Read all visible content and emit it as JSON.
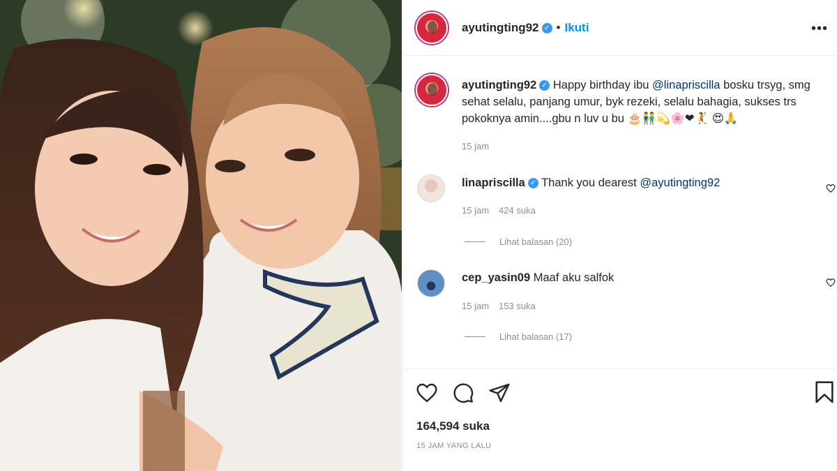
{
  "post": {
    "username": "ayutingting92",
    "follow_label": "Ikuti",
    "separator": "•",
    "more_icon": "more-horizontal-icon"
  },
  "caption": {
    "username": "ayutingting92",
    "text_before": "Happy birthday ibu ",
    "mention": "@linapriscilla",
    "text_after": " bosku trsyg, smg sehat selalu, panjang umur, byk rezeki, selalu bahagia, sukses trs pokoknya amin....gbu n luv u bu 🎂👬💫🌸❤🤾 😍🙏",
    "time": "15 jam"
  },
  "comments": [
    {
      "username": "linapriscilla",
      "verified": true,
      "text_before": "Thank you dearest ",
      "mention": "@ayutingting92",
      "time": "15 jam",
      "likes": "424 suka",
      "replies": "Lihat balasan (20)"
    },
    {
      "username": "cep_yasin09",
      "verified": false,
      "text_before": "Maaf aku salfok",
      "mention": "",
      "time": "15 jam",
      "likes": "153 suka",
      "replies": "Lihat balasan (17)"
    }
  ],
  "actions": {
    "like_icon": "heart-icon",
    "comment_icon": "comment-icon",
    "share_icon": "share-icon",
    "save_icon": "bookmark-icon",
    "likes_total": "164,594 suka",
    "time_ago": "15 JAM YANG LALU"
  },
  "colors": {
    "link": "#00376b",
    "follow": "#0095f6",
    "verified": "#3897f0",
    "muted": "#8e8e8e"
  }
}
